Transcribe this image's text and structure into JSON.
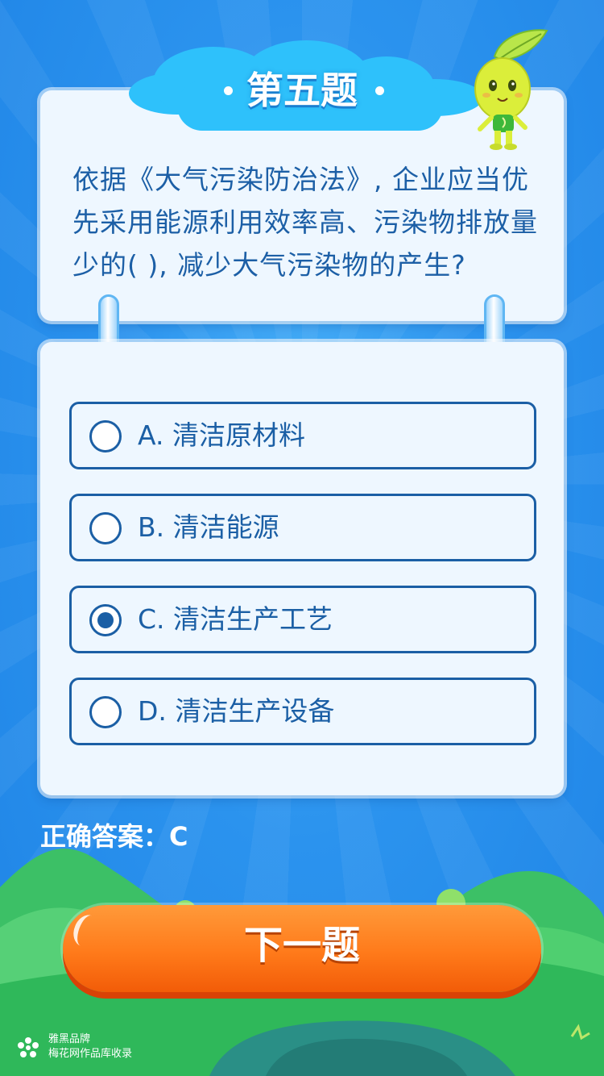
{
  "header": {
    "title": "第五题"
  },
  "question": {
    "text": "依据《大气污染防治法》, 企业应当优先采用能源利用效率高、污染物排放量少的(   ), 减少大气污染物的产生?"
  },
  "options": [
    {
      "letter": "A",
      "label": "A. 清洁原材料",
      "selected": false
    },
    {
      "letter": "B",
      "label": "B. 清洁能源",
      "selected": false
    },
    {
      "letter": "C",
      "label": "C. 清洁生产工艺",
      "selected": true
    },
    {
      "letter": "D",
      "label": "D. 清洁生产设备",
      "selected": false
    }
  ],
  "answer": {
    "text": "正确答案：C"
  },
  "next_button": {
    "label": "下一题"
  },
  "brand": {
    "name": "雅黑品牌",
    "subtitle": "梅花网作品库收录"
  },
  "colors": {
    "background": "#2b93ee",
    "card": "#eef7ff",
    "accent": "#1b5fa5",
    "button": "#ff7a1a",
    "cloud": "#2ec1fb"
  },
  "icons": {
    "mascot": "leaf-mascot-icon",
    "brand": "plum-blossom-icon"
  }
}
